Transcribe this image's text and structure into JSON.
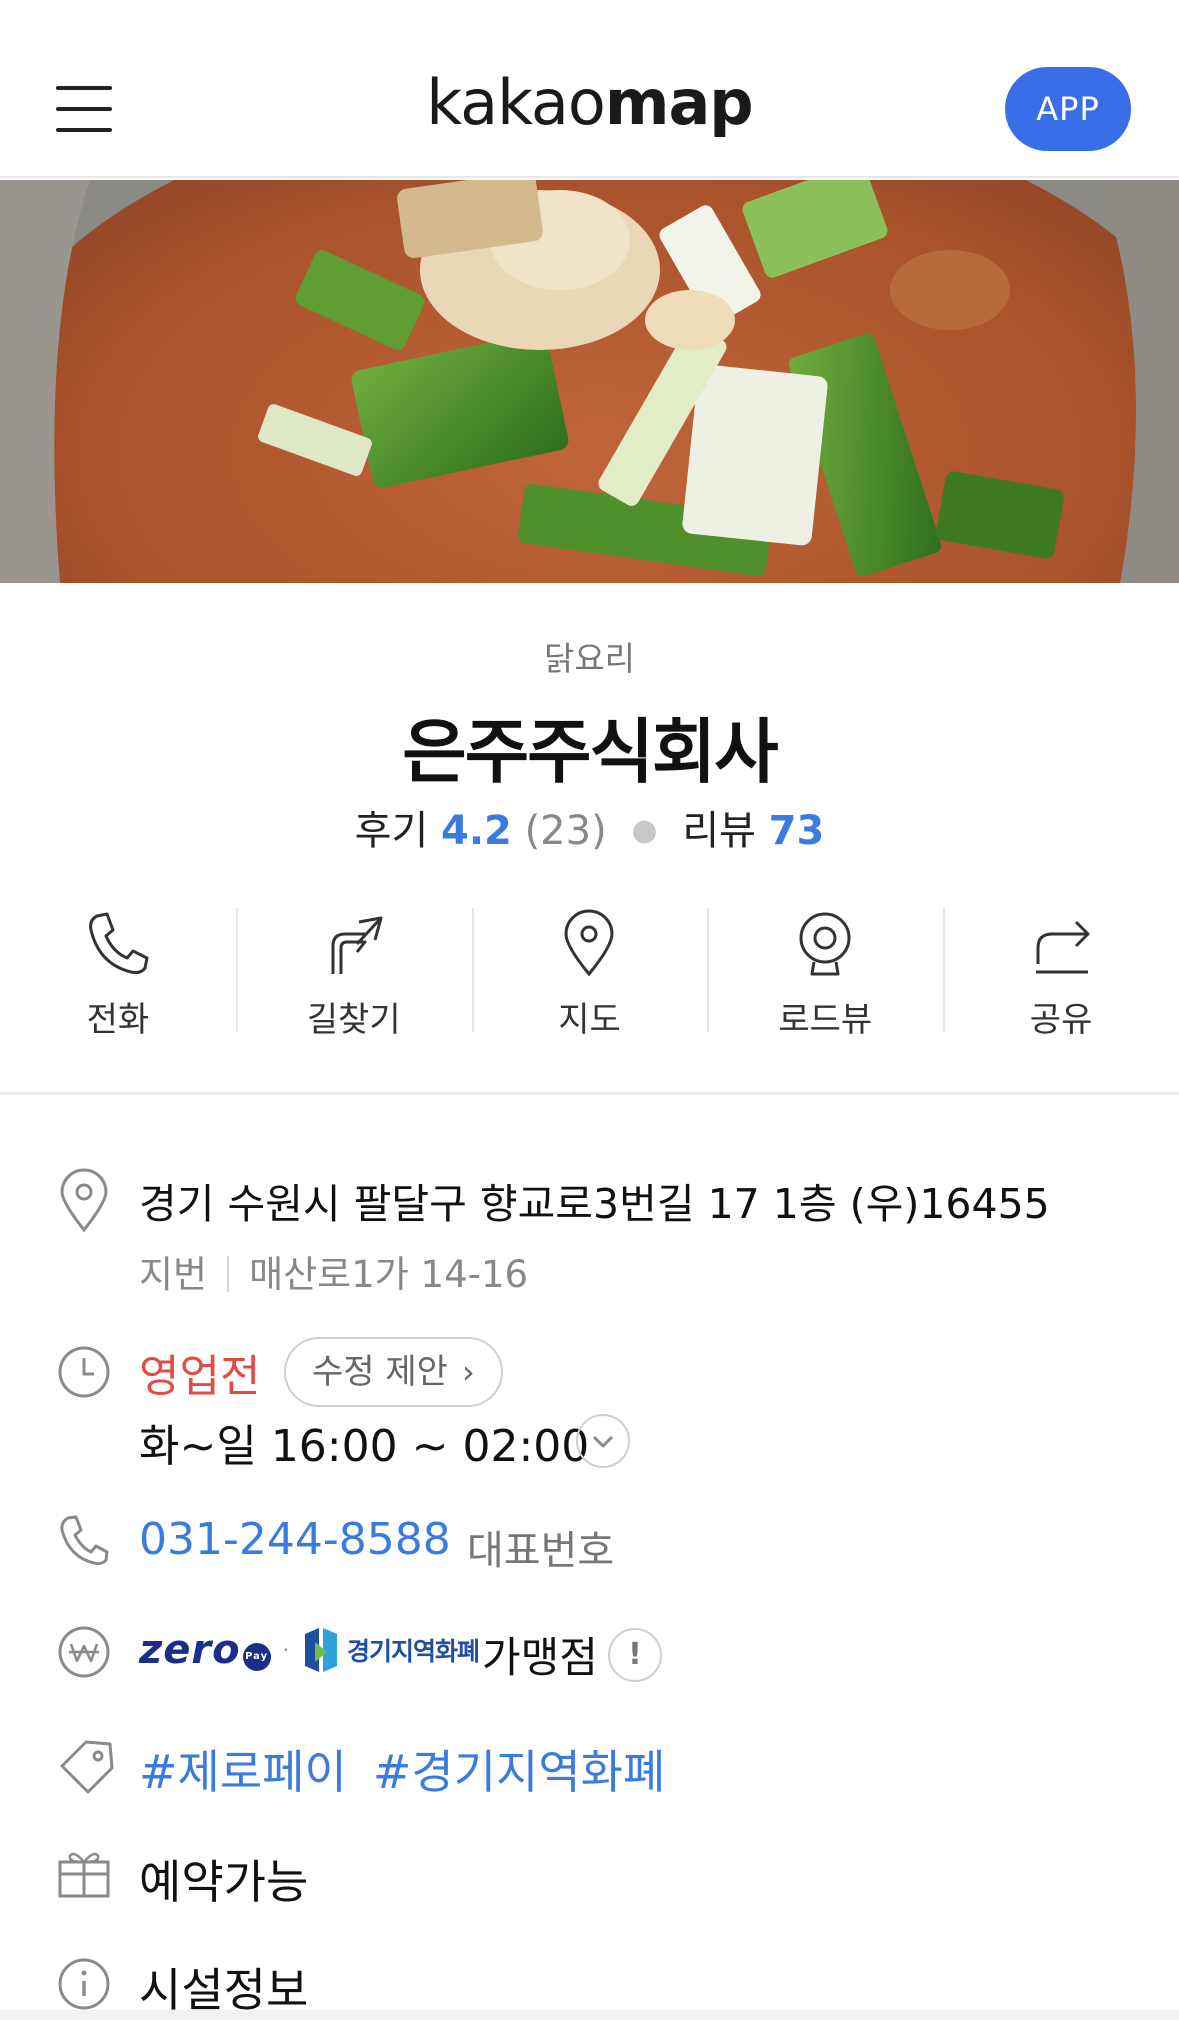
{
  "header": {
    "logo_part1": "kakao",
    "logo_part2": "map",
    "app_button": "APP"
  },
  "place": {
    "category": "닭요리",
    "name": "은주주식회사",
    "rating_label": "후기",
    "rating": "4.2",
    "rating_count": "(23)",
    "review_label": "리뷰",
    "review_count": "73"
  },
  "actions": [
    {
      "label": "전화",
      "icon": "phone-icon"
    },
    {
      "label": "길찾기",
      "icon": "directions-icon"
    },
    {
      "label": "지도",
      "icon": "map-pin-icon"
    },
    {
      "label": "로드뷰",
      "icon": "roadview-icon"
    },
    {
      "label": "공유",
      "icon": "share-icon"
    }
  ],
  "info": {
    "address": "경기 수원시 팔달구 향교로3번길 17 1층 (우)16455",
    "jibun_label": "지번",
    "jibun_address": "매산로1가 14-16",
    "status": "영업전",
    "suggest_button": "수정 제안",
    "hours": "화~일 16:00 ~ 02:00",
    "phone": "031-244-8588",
    "phone_type": "대표번호",
    "zero_pay_logo": "zero",
    "zero_pay_badge": "Pay",
    "gyeonggi_currency_logo": "경기지역화폐",
    "merchant_label": "가맹점",
    "info_mark": "!",
    "tags": [
      "#제로페이",
      "#경기지역화폐"
    ],
    "reservation": "예약가능",
    "facility": "시설정보"
  },
  "colors": {
    "accent_blue": "#3a7be0",
    "app_button": "#3a6ee8",
    "status_red": "#e34b45",
    "text_gray": "#888888"
  }
}
